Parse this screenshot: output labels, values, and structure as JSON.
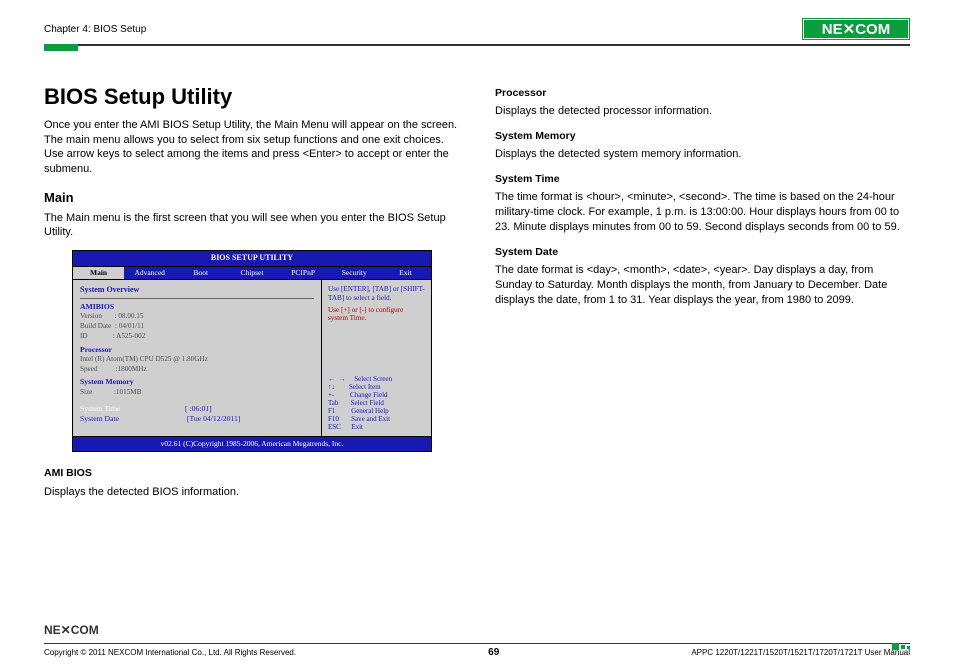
{
  "header": {
    "chapter": "Chapter 4: BIOS Setup",
    "brand": "NEXCOM"
  },
  "left": {
    "title": "BIOS Setup Utility",
    "intro": "Once you enter the AMI BIOS Setup Utility, the Main Menu will appear on the screen. The main menu allows you to select from six setup functions and one exit choices. Use arrow keys to select among the items and press <Enter> to accept or enter the submenu.",
    "main_heading": "Main",
    "main_desc": "The Main menu is the first screen that you will see when you enter the BIOS Setup Utility.",
    "ami_label": "AMI BIOS",
    "ami_desc": "Displays the detected BIOS information."
  },
  "right": {
    "proc_label": "Processor",
    "proc_desc": "Displays the detected processor information.",
    "mem_label": "System Memory",
    "mem_desc": "Displays the detected system memory information.",
    "time_label": "System Time",
    "time_desc": "The time format is <hour>, <minute>, <second>. The time is based on the 24-hour military-time clock. For example, 1 p.m. is 13:00:00. Hour displays hours from 00 to 23. Minute displays minutes from 00 to 59. Second displays seconds from 00 to 59.",
    "date_label": "System Date",
    "date_desc": "The date format is <day>, <month>, <date>, <year>. Day displays a day, from Sunday to Saturday. Month displays the month, from January to December. Date displays the date, from 1 to 31. Year displays the year, from 1980 to 2099."
  },
  "bios": {
    "title": "BIOS SETUP UTILITY",
    "tabs": [
      "Main",
      "Advanced",
      "Boot",
      "Chipset",
      "PCIPnP",
      "Security",
      "Exit"
    ],
    "overview": "System Overview",
    "amibios": "AMIBIOS",
    "version": "Version       : 08.00.15",
    "build": "Build Date  : 04/01/11",
    "id": "ID              : A525-002",
    "processor": "Processor",
    "cpu": "Intel (R) Atom(TM) CPU D525 @ 1.80GHz",
    "speed": "Speed          :1800MHz",
    "sysmem": "System Memory",
    "size": "Size            :1015MB",
    "systime_label": "System Time",
    "systime_val": "[  :06:01]",
    "sysdate_label": "System Date",
    "sysdate_val": "[Tue 04/12/2011]",
    "help1": "Use [ENTER], [TAB] or [SHIFT-TAB] to select a field.",
    "help2": "Use [+] or [-] to configure system Time.",
    "keys": {
      "k1": "←  →     Select Screen",
      "k2": "↑↓        Select Item",
      "k3": "+-         Change Field",
      "k4": "Tab       Select Field",
      "k5": "F1         General Help",
      "k6": "F10       Save and Exit",
      "k7": "ESC      Exit"
    },
    "footer": "v02.61 (C)Copyright 1985-2006, American Megatrends, Inc."
  },
  "footer": {
    "copyright": "Copyright © 2011 NEXCOM International Co., Ltd. All Rights Reserved.",
    "page": "69",
    "manual": "APPC 1220T/1221T/1520T/1521T/1720T/1721T User Manual"
  }
}
